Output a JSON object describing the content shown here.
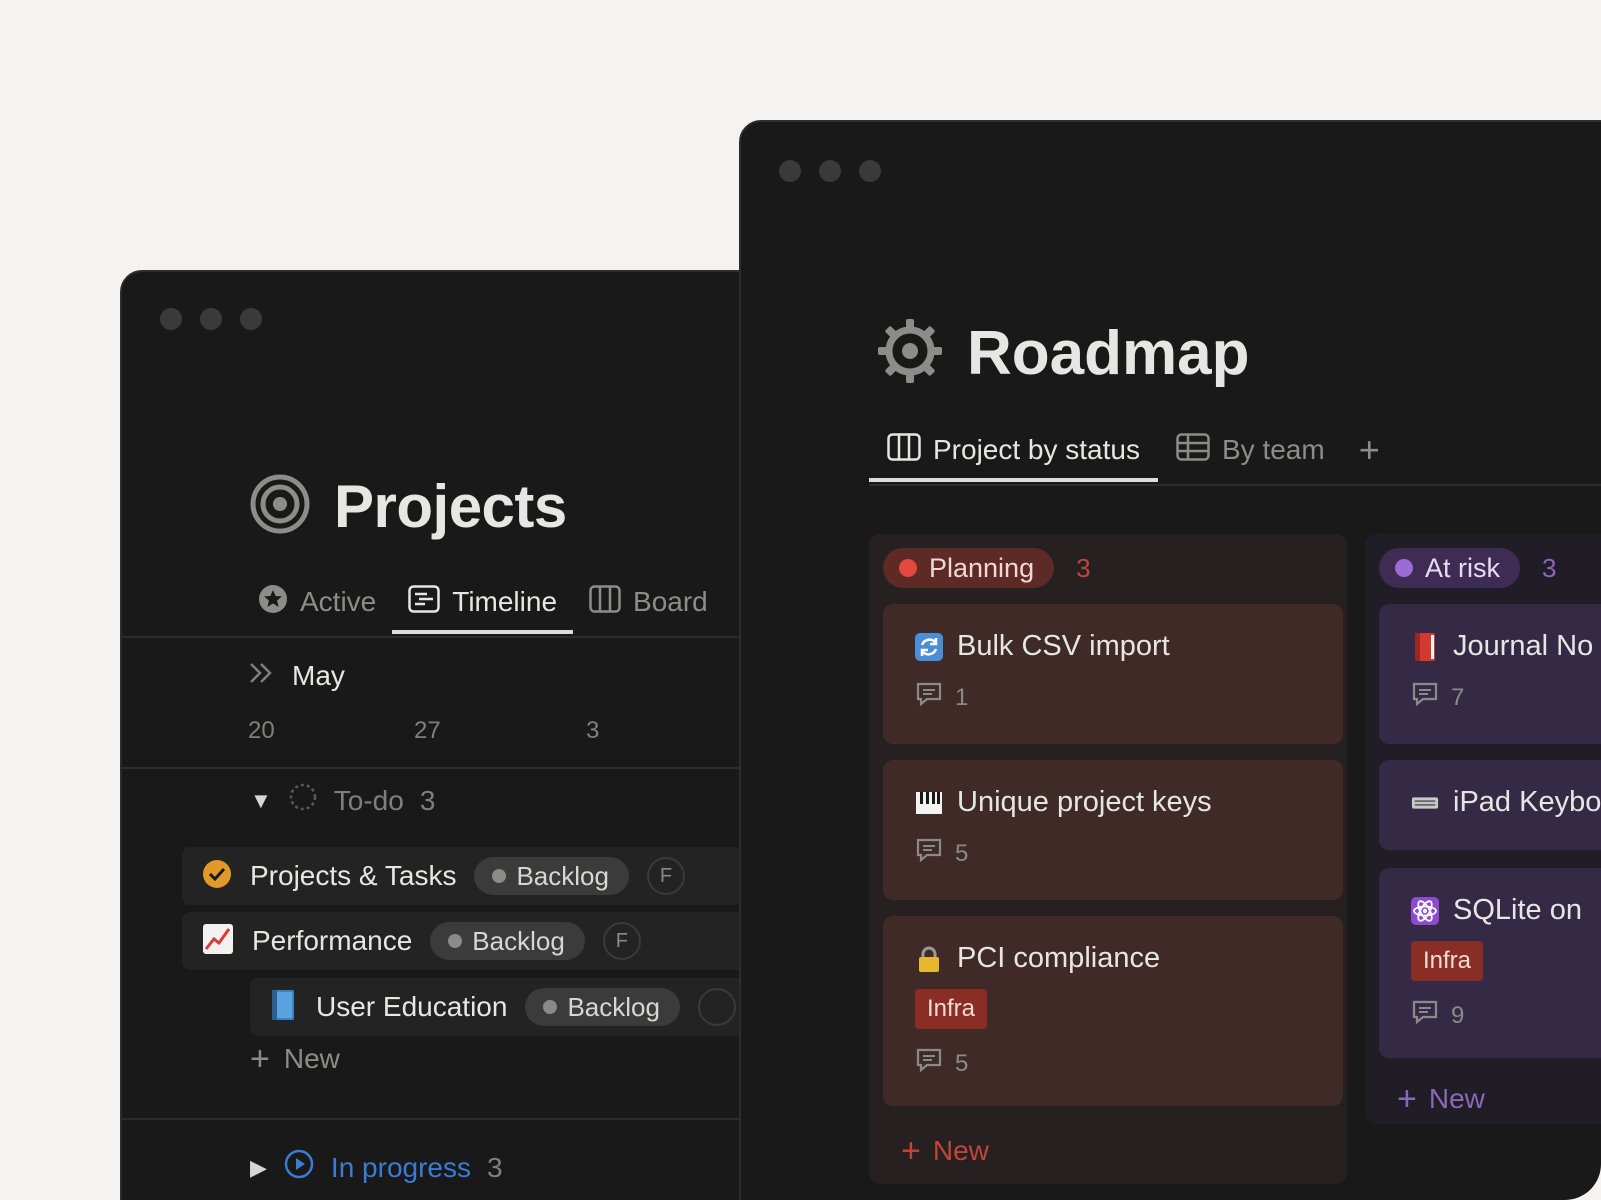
{
  "left_window": {
    "title": "Projects",
    "tabs": [
      {
        "label": "Active",
        "icon": "star-circle-icon"
      },
      {
        "label": "Timeline",
        "icon": "timeline-icon"
      },
      {
        "label": "Board",
        "icon": "board-icon"
      }
    ],
    "timeline": {
      "month": "May",
      "dates": [
        "20",
        "27",
        "3"
      ]
    },
    "todo_group": {
      "label": "To-do",
      "count": "3"
    },
    "rows": [
      {
        "label": "Projects & Tasks",
        "status": "Backlog",
        "avatar": "F",
        "icon": "check-circle-icon"
      },
      {
        "label": "Performance",
        "status": "Backlog",
        "avatar": "F",
        "icon": "chart-increasing-icon"
      },
      {
        "label": "User Education",
        "status": "Backlog",
        "icon": "blue-book-icon"
      }
    ],
    "new_label": "New",
    "progress_group": {
      "label": "In progress",
      "count": "3"
    }
  },
  "right_window": {
    "title": "Roadmap",
    "tabs": [
      {
        "label": "Project by status",
        "icon": "board-icon"
      },
      {
        "label": "By team",
        "icon": "table-icon"
      }
    ],
    "add_view": "+",
    "columns": [
      {
        "status": "Planning",
        "count": "3",
        "color": "#d94f45",
        "cards": [
          {
            "title": "Bulk CSV import",
            "icon": "arrows-cycle-icon",
            "comments": "1"
          },
          {
            "title": "Unique project keys",
            "icon": "piano-keys-icon",
            "comments": "5"
          },
          {
            "title": "PCI compliance",
            "icon": "lock-icon",
            "tag": "Infra",
            "comments": "5"
          }
        ],
        "new_label": "New"
      },
      {
        "status": "At risk",
        "count": "3",
        "color": "#9b6bd6",
        "cards": [
          {
            "title": "Journal No",
            "icon": "red-book-icon",
            "comments": "7"
          },
          {
            "title": "iPad Keybo",
            "icon": "keyboard-icon"
          },
          {
            "title": "SQLite on",
            "icon": "atom-icon",
            "tag": "Infra",
            "comments": "9"
          }
        ],
        "new_label": "New"
      }
    ]
  }
}
